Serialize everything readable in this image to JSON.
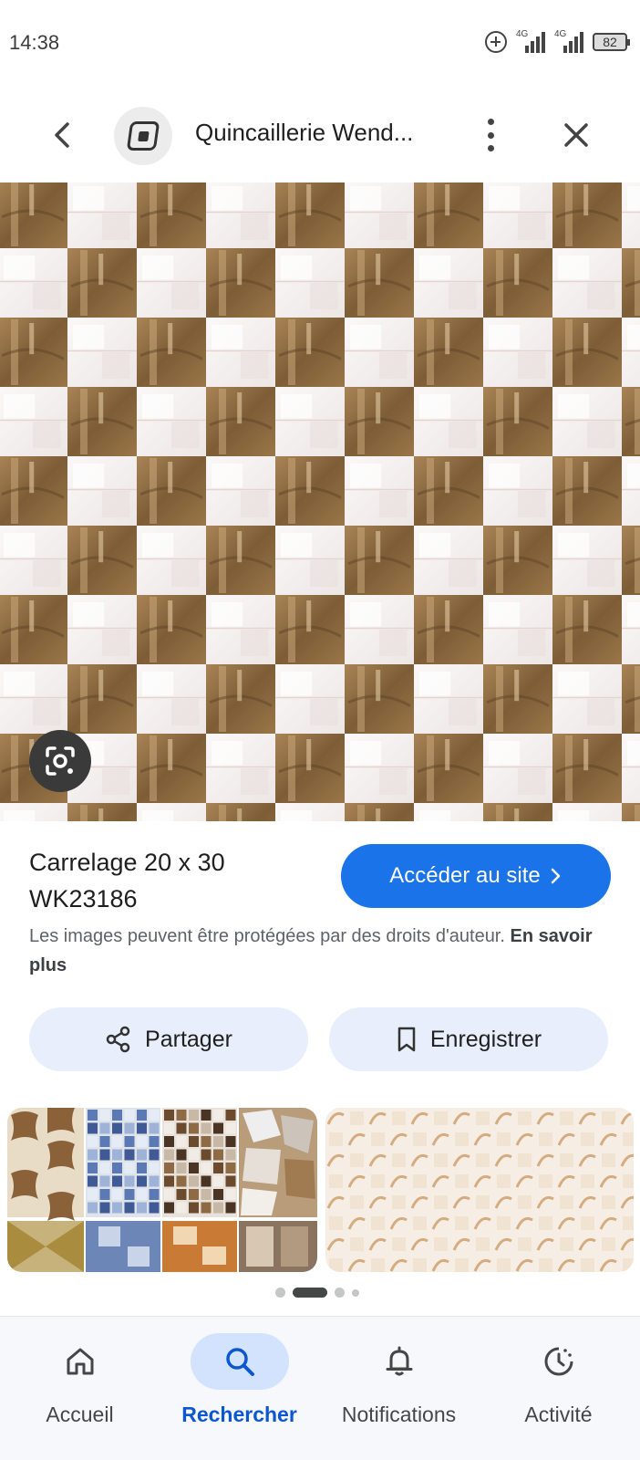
{
  "status_bar": {
    "time": "14:38",
    "signal1_label": "4G",
    "signal2_label": "4G",
    "battery": "82"
  },
  "app_bar": {
    "title": "Quincaillerie Wend...",
    "back_icon": "chevron-left-icon",
    "more_icon": "more-vertical-icon",
    "close_icon": "close-icon"
  },
  "result": {
    "title": "Carrelage 20 x 30 WK23186",
    "visit_label": "Accéder au site",
    "copyright_text": "Les images peuvent être protégées par des droits d'auteur. ",
    "learn_more": "En savoir plus",
    "share_label": "Partager",
    "save_label": "Enregistrer"
  },
  "carousel": {
    "pages": 4,
    "active_index": 1
  },
  "bottom_nav": {
    "items": [
      {
        "label": "Accueil",
        "icon": "home-icon",
        "active": false
      },
      {
        "label": "Rechercher",
        "icon": "search-icon",
        "active": true
      },
      {
        "label": "Notifications",
        "icon": "bell-icon",
        "active": false
      },
      {
        "label": "Activité",
        "icon": "activity-icon",
        "active": false
      }
    ]
  },
  "colors": {
    "accent": "#1a73e8",
    "pill_bg": "#e8eefb",
    "nav_active_bg": "#d3e3fd",
    "nav_active_text": "#0b57d0",
    "tile_brown": "#8b6a43",
    "tile_white": "#f4f1ef"
  }
}
